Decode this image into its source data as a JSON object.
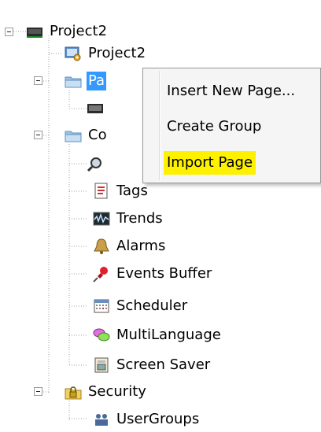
{
  "tree": {
    "root": {
      "label": "Project2",
      "icon": "monitor-icon"
    },
    "items": [
      {
        "label": "Project2",
        "icon": "project-settings-icon"
      },
      {
        "label": "Pa",
        "icon": "folder-icon",
        "selected": true
      },
      {
        "label": "",
        "icon": "screen-page-icon"
      },
      {
        "label": "Co",
        "icon": "folder-icon"
      },
      {
        "label": "",
        "icon": "magnifier-gear-icon"
      },
      {
        "label": "Tags",
        "icon": "tags-document-icon"
      },
      {
        "label": "Trends",
        "icon": "trends-graph-icon"
      },
      {
        "label": "Alarms",
        "icon": "alarm-bell-icon"
      },
      {
        "label": "Events Buffer",
        "icon": "pushpin-icon"
      },
      {
        "label": "Scheduler",
        "icon": "calendar-icon"
      },
      {
        "label": "MultiLanguage",
        "icon": "speech-bubbles-icon"
      },
      {
        "label": "Screen Saver",
        "icon": "screen-saver-icon"
      },
      {
        "label": "Security",
        "icon": "security-folder-icon"
      },
      {
        "label": "UserGroups",
        "icon": "user-groups-icon"
      }
    ]
  },
  "context_menu": {
    "items": [
      {
        "label": "Insert New Page..."
      },
      {
        "label": "Create Group"
      },
      {
        "label": "Import Page",
        "highlighted": true
      }
    ],
    "highlight_color": "#fdf100"
  },
  "colors": {
    "selection": "#3399ff",
    "folder": "#9cc3e6"
  }
}
